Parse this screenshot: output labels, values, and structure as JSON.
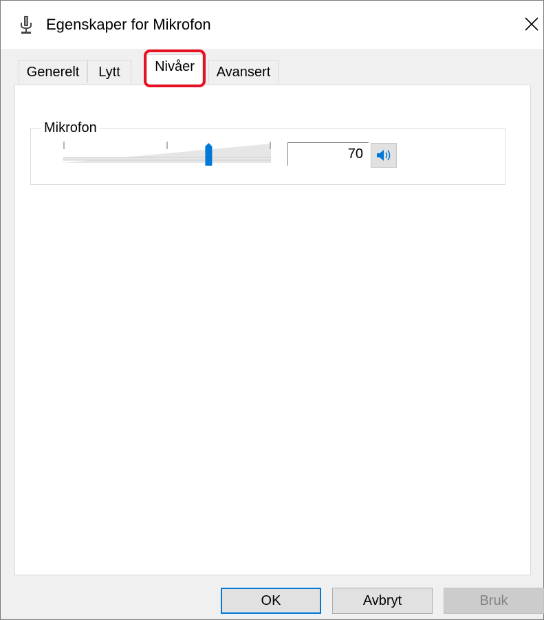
{
  "window": {
    "title": "Egenskaper for Mikrofon",
    "close_glyph": "✕"
  },
  "tabs": [
    {
      "label": "Generelt",
      "active": false
    },
    {
      "label": "Lytt",
      "active": false
    },
    {
      "label": "Nivåer",
      "active": true
    },
    {
      "label": "Avansert",
      "active": false
    }
  ],
  "levels": {
    "group_label": "Mikrofon",
    "value": "70",
    "slider_level_percent": 70,
    "speaker_icon": "speaker-icon"
  },
  "buttons": {
    "ok": "OK",
    "cancel": "Avbryt",
    "apply": "Bruk"
  },
  "colors": {
    "accent": "#0078d7",
    "highlight": "#e81123"
  }
}
